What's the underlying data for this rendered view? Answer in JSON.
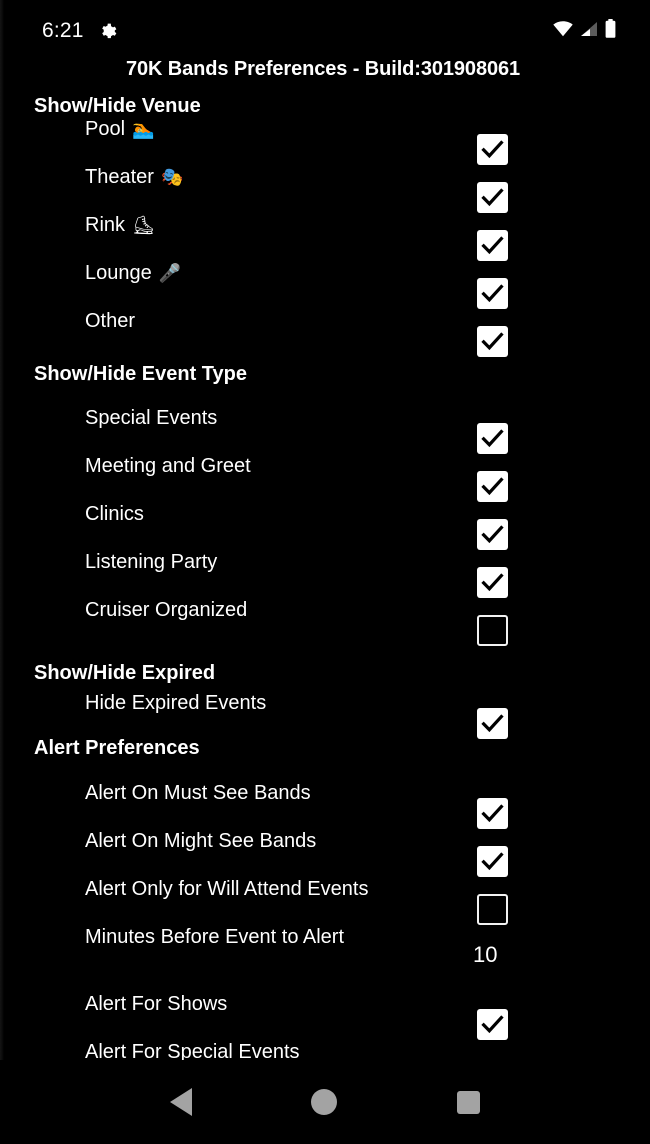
{
  "statusbar": {
    "clock": "6:21",
    "gear_icon": "gear-icon",
    "wifi_icon": "wifi-icon",
    "cellular_icon": "cellular-signal-icon",
    "battery_icon": "battery-full-icon"
  },
  "header": {
    "title": "70K Bands Preferences - Build:301908061"
  },
  "colors": {
    "background": "#000000",
    "text": "#ffffff",
    "checkbox_on_fill": "#ffffff",
    "checkbox_check": "#000000",
    "checkbox_off_border": "#f2f2f2",
    "nav_icon": "#a3a3a3"
  },
  "sections": [
    {
      "header": "Show/Hide Venue",
      "rows": [
        {
          "label": "Pool",
          "emoji": "🏊",
          "control": "checkbox",
          "checked": true
        },
        {
          "label": "Theater",
          "emoji": "🎭",
          "control": "checkbox",
          "checked": true
        },
        {
          "label": "Rink",
          "emoji": "⛸",
          "control": "checkbox",
          "checked": true
        },
        {
          "label": "Lounge",
          "emoji": "🎤",
          "control": "checkbox",
          "checked": true
        },
        {
          "label": "Other",
          "emoji": "",
          "control": "checkbox",
          "checked": true
        }
      ]
    },
    {
      "header": "Show/Hide Event Type",
      "rows": [
        {
          "label": "Special Events",
          "emoji": "",
          "control": "checkbox",
          "checked": true
        },
        {
          "label": "Meeting and Greet",
          "emoji": "",
          "control": "checkbox",
          "checked": true
        },
        {
          "label": "Clinics",
          "emoji": "",
          "control": "checkbox",
          "checked": true
        },
        {
          "label": "Listening Party",
          "emoji": "",
          "control": "checkbox",
          "checked": true
        },
        {
          "label": "Cruiser Organized",
          "emoji": "",
          "control": "checkbox",
          "checked": false
        }
      ]
    },
    {
      "header": "Show/Hide Expired",
      "rows": [
        {
          "label": "Hide Expired Events",
          "emoji": "",
          "control": "checkbox",
          "checked": true
        }
      ]
    },
    {
      "header": "Alert Preferences",
      "rows": [
        {
          "label": "Alert On Must See Bands",
          "emoji": "",
          "control": "checkbox",
          "checked": true
        },
        {
          "label": "Alert On Might See Bands",
          "emoji": "",
          "control": "checkbox",
          "checked": true
        },
        {
          "label": "Alert Only for Will Attend Events",
          "emoji": "",
          "control": "checkbox",
          "checked": false
        },
        {
          "label": "Minutes Before Event to Alert",
          "emoji": "",
          "control": "value",
          "value": "10"
        },
        {
          "label": "Alert For Shows",
          "emoji": "",
          "control": "checkbox",
          "checked": true
        },
        {
          "label": "Alert For Special Events",
          "emoji": "",
          "control": "none",
          "clipped": true
        }
      ]
    }
  ],
  "navbar": {
    "back_label": "back-button",
    "home_label": "home-button",
    "recents_label": "recents-button"
  }
}
